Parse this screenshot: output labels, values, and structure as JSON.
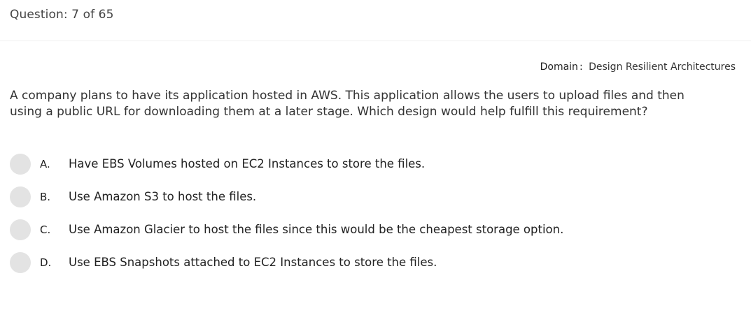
{
  "header": {
    "question_counter": "Question: 7 of 65"
  },
  "domain": {
    "label": "Domain",
    "colon": ":",
    "value": "Design Resilient Architectures"
  },
  "question": {
    "text": "A company plans to have its application hosted in AWS. This application allows the users to upload files and then using a public URL for downloading them at a later stage. Which design would help fulfill this requirement?"
  },
  "options": [
    {
      "letter": "A.",
      "text": "Have EBS Volumes hosted on EC2 Instances to store the files."
    },
    {
      "letter": "B.",
      "text": "Use Amazon S3 to host the files."
    },
    {
      "letter": "C.",
      "text": "Use Amazon Glacier to host the files since this would be the cheapest storage option."
    },
    {
      "letter": "D.",
      "text": "Use EBS Snapshots attached to EC2 Instances to store the files."
    }
  ]
}
